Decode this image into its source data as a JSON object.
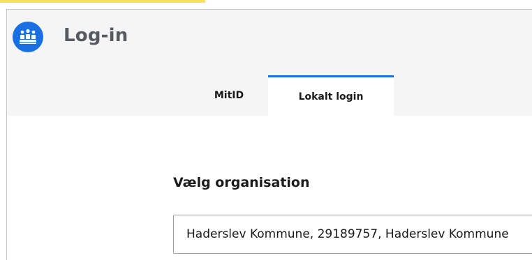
{
  "header": {
    "title": "Log-in",
    "logo_icon": "crown-people-icon",
    "accent_color": "#1a6fe3"
  },
  "tabs": [
    {
      "label": "MitID",
      "active": false
    },
    {
      "label": "Lokalt login",
      "active": true
    }
  ],
  "organisation": {
    "label": "Vælg organisation",
    "value": "Haderslev Kommune, 29189757, Haderslev Kommune"
  }
}
